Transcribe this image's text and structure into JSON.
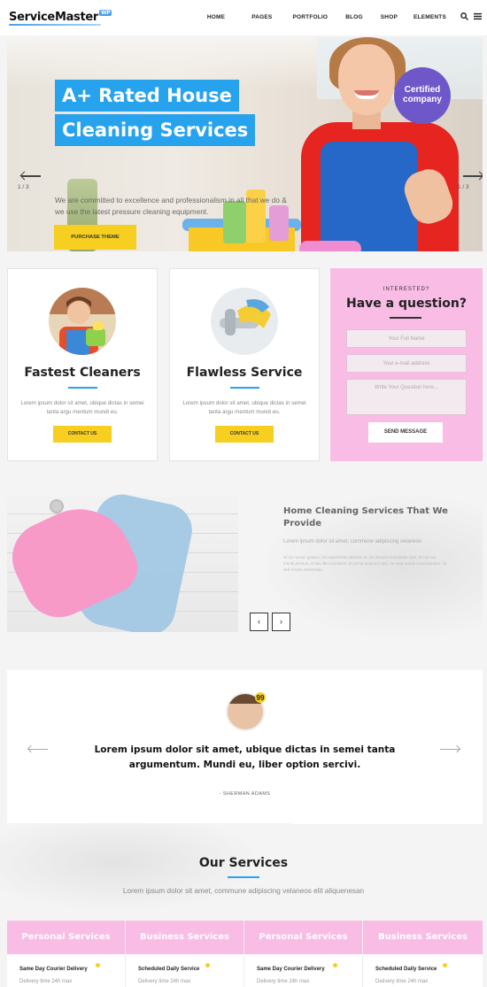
{
  "header": {
    "logo_text": "ServiceMaster",
    "logo_badge": "WP",
    "nav": [
      "HOME",
      "PAGES",
      "PORTFOLIO",
      "BLOG",
      "SHOP",
      "ELEMENTS"
    ]
  },
  "hero": {
    "title_line1": "A+ Rated House",
    "title_line2": "Cleaning Services",
    "description": "We are committed to excellence and professionalism in all that we do & we use the latest pressure cleaning equipment.",
    "button": "PURCHASE THEME",
    "slide_left": "1 / 3",
    "slide_right": "1 / 3",
    "badge": "Certified company"
  },
  "cards": [
    {
      "title": "Fastest Cleaners",
      "text": "Lorem ipsum dolor sit amet, ubique dictas in semei tanta argu mentum mundi eu.",
      "button": "CONTACT US"
    },
    {
      "title": "Flawless Service",
      "text": "Lorem ipsum dolor sit amet, ubique dictas in semei tanta argu mentum mundi eu.",
      "button": "CONTACT US"
    }
  ],
  "question_form": {
    "kicker": "INTERESTED?",
    "title": "Have a question?",
    "name_placeholder": "Your Full Name",
    "email_placeholder": "Your e-mail address",
    "question_placeholder": "Write Your Question here...",
    "button": "SEND MESSAGE"
  },
  "about": {
    "title": "Home Cleaning Services That We Provide",
    "subtitle": "Lorem ipsum dolor sit amet, commune adipiscing velaneos",
    "text": "At vix novum graeco, his expetendis detracto et. Ne discere honestatis nam. Et usu ea mundi persius, in has liber inciderint. Ei prima dolorum nam, eu mea omnis consequuntur. Ut sed scripta sententiae."
  },
  "testimonial": {
    "quote_mark": "99",
    "text": "Lorem ipsum dolor sit amet, ubique dictas in semei tanta argumentum. Mundi eu, liber option sercivi.",
    "author": "- SHERMAN ADAMS"
  },
  "services": {
    "title": "Our Services",
    "subtitle": "Lorem ipsum dolor sit amet, commune adipiscing velaneos elit aliquenesan",
    "columns": [
      {
        "head": "Personal Services",
        "item": "Same Day Courier Delivery",
        "meta": "Delivery time 24h max"
      },
      {
        "head": "Business Services",
        "item": "Scheduled Daily Service",
        "meta": "Delivery time 24h max"
      },
      {
        "head": "Personal Services",
        "item": "Same Day Courier Delivery",
        "meta": "Delivery time 24h max"
      },
      {
        "head": "Business Services",
        "item": "Scheduled Daily Service",
        "meta": "Delivery time 24h max"
      }
    ]
  },
  "colors": {
    "accent_blue": "#27a3ee",
    "accent_yellow": "#f6cf20",
    "accent_pink": "#f8bce5"
  },
  "icons": {
    "search": "search-icon",
    "menu": "hamburger-menu-icon",
    "prev": "arrow-left-icon",
    "next": "arrow-right-icon"
  }
}
